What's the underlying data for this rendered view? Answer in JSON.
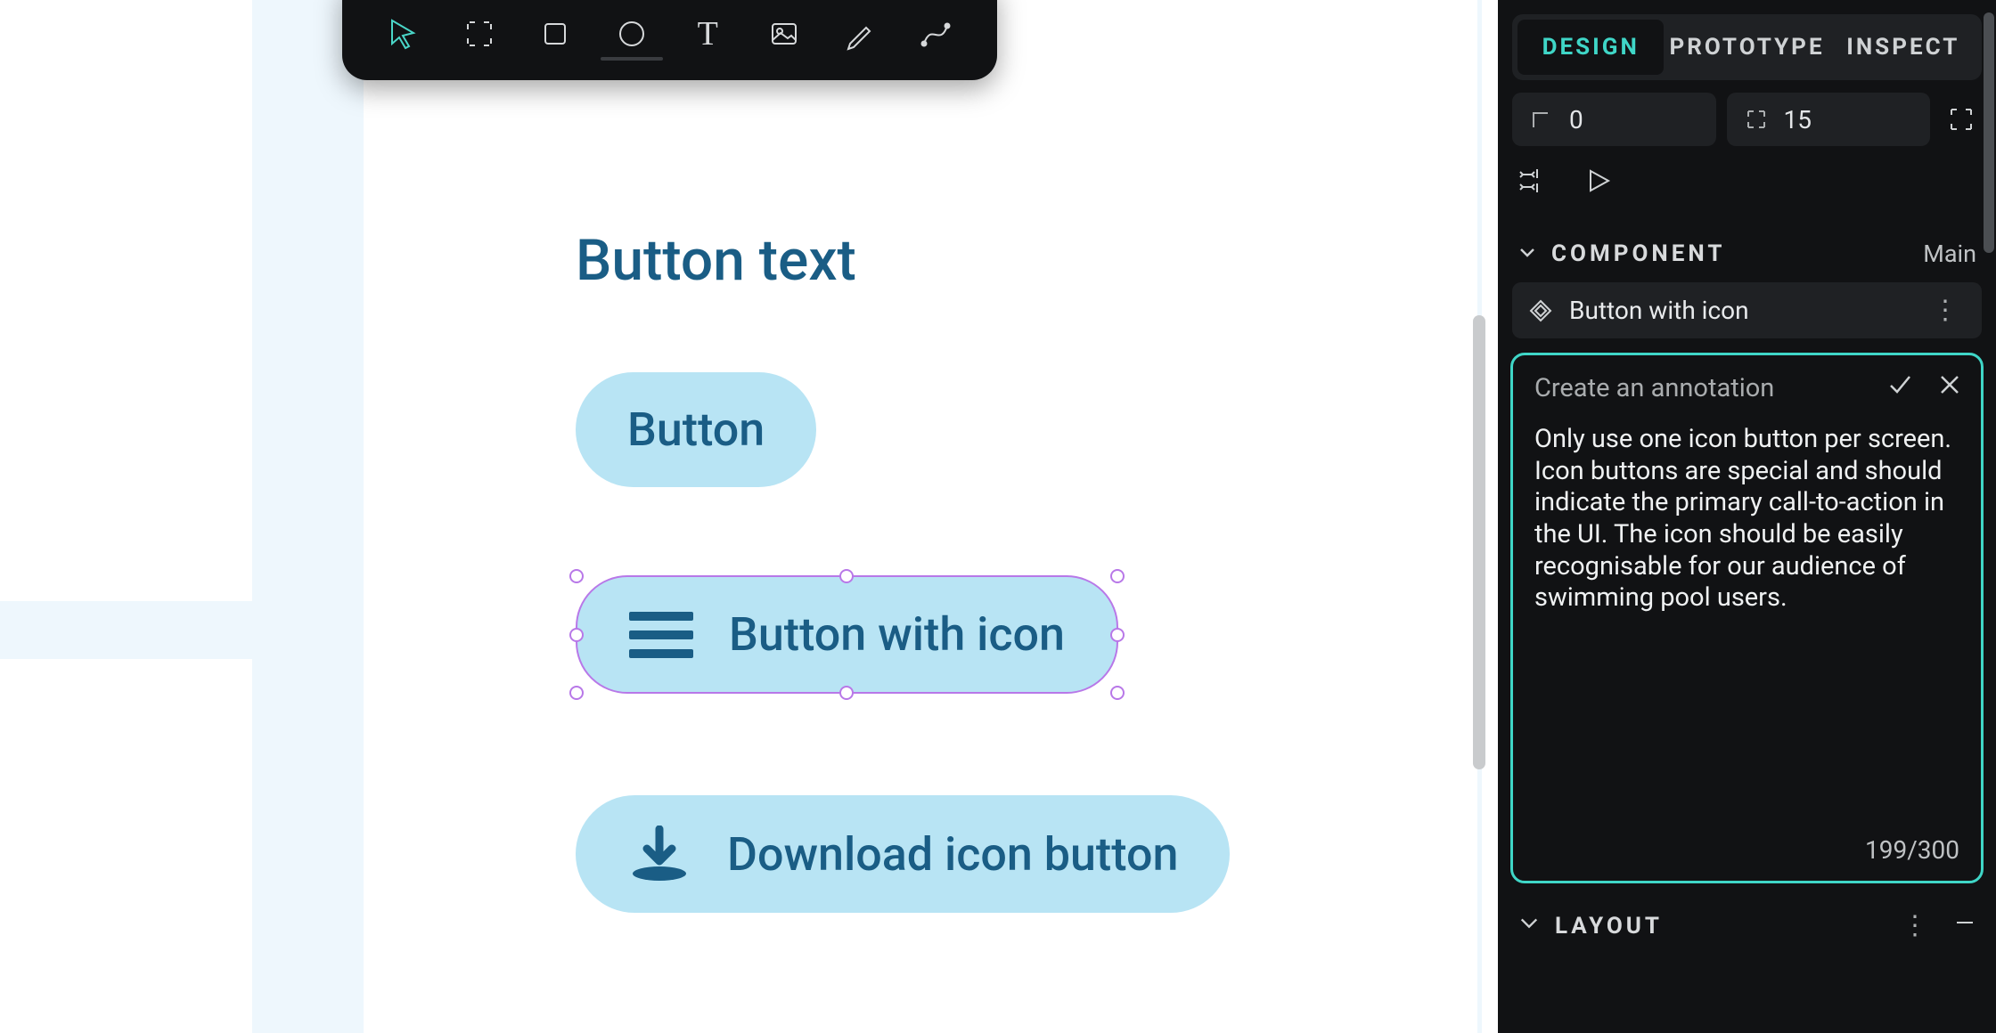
{
  "canvas": {
    "heading": "Button text",
    "buttons": {
      "one": "Button",
      "two": "Button with icon",
      "three": "Download icon button"
    }
  },
  "toolbar": {
    "tools": [
      "select",
      "frame",
      "rectangle",
      "ellipse",
      "text",
      "image",
      "pen",
      "curve"
    ]
  },
  "panel": {
    "tabs": {
      "design": "DESIGN",
      "prototype": "PROTOTYPE",
      "inspect": "INSPECT"
    },
    "dims": {
      "rotation": "0",
      "radius": "15"
    },
    "component": {
      "section": "COMPONENT",
      "main": "Main",
      "name": "Button with icon"
    },
    "annotation": {
      "placeholder": "Create an annotation",
      "text": "Only use one icon button per screen. Icon buttons are special and should indicate the primary call-to-action in the UI. The icon should be easily recognisable for our audience of swimming pool users.",
      "counter": "199/300"
    },
    "layout": {
      "section": "LAYOUT"
    }
  }
}
